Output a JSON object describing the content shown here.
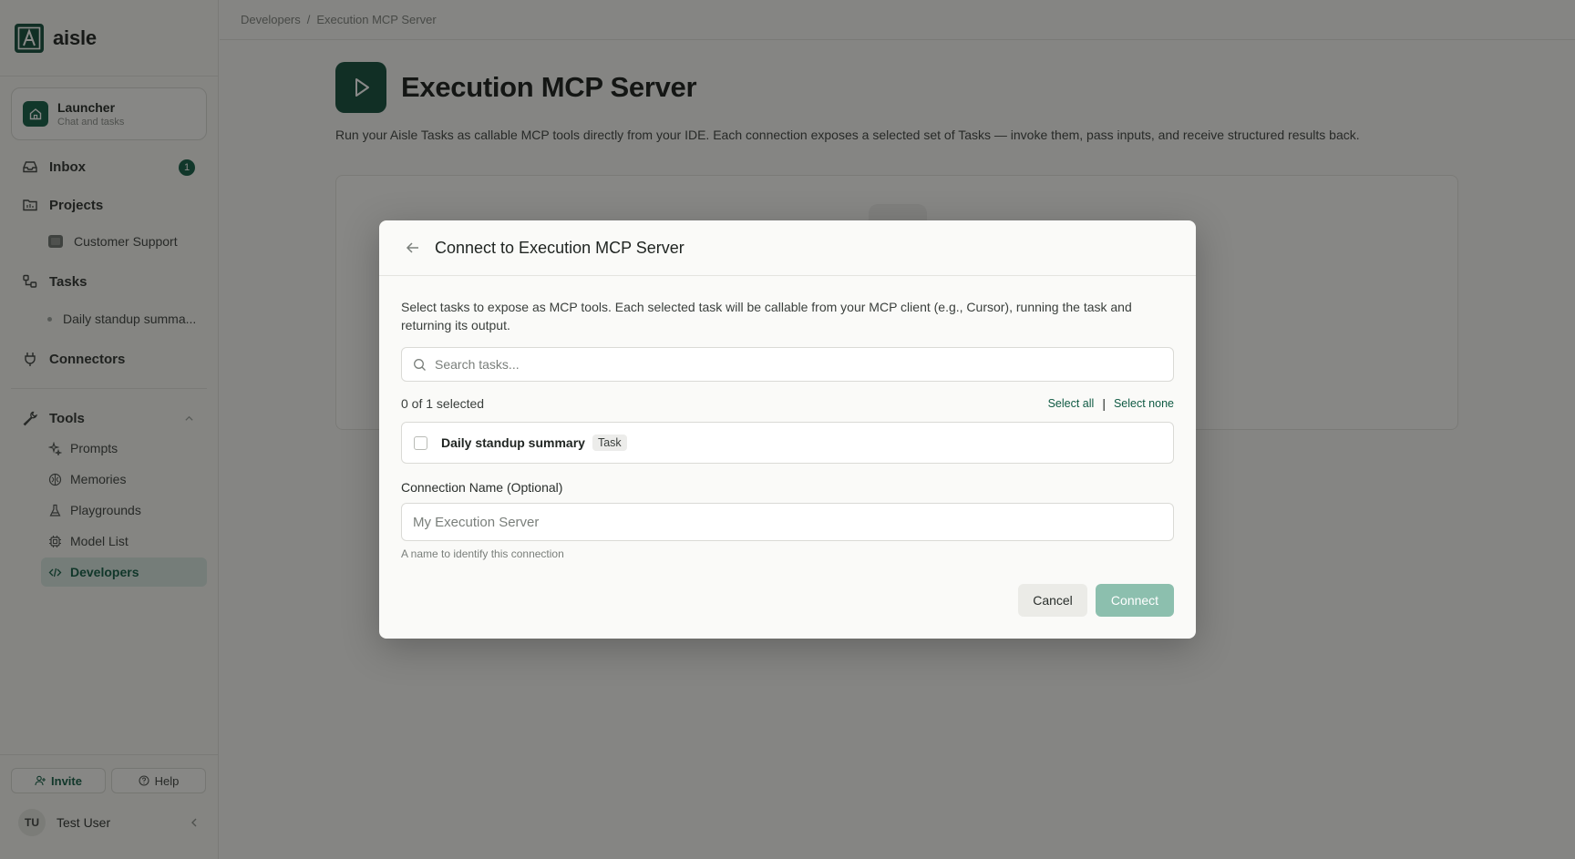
{
  "brand": {
    "name": "aisle"
  },
  "launcher": {
    "title": "Launcher",
    "subtitle": "Chat and tasks"
  },
  "nav": {
    "inbox": {
      "label": "Inbox",
      "badge": "1"
    },
    "projects": {
      "label": "Projects",
      "children": [
        "Customer Support"
      ]
    },
    "tasks": {
      "label": "Tasks",
      "children": [
        "Daily standup summa..."
      ]
    },
    "connectors": {
      "label": "Connectors"
    },
    "tools": {
      "label": "Tools",
      "items": [
        "Prompts",
        "Memories",
        "Playgrounds",
        "Model List",
        "Developers"
      ],
      "active": "Developers"
    }
  },
  "footer": {
    "invite_label": "Invite",
    "help_label": "Help"
  },
  "user": {
    "initials": "TU",
    "name": "Test User"
  },
  "breadcrumb": [
    "Developers",
    "Execution MCP Server"
  ],
  "page": {
    "title": "Execution MCP Server",
    "description": "Run your Aisle Tasks as callable MCP tools directly from your IDE. Each connection exposes a selected set of Tasks — invoke them, pass inputs, and receive structured results back."
  },
  "modal": {
    "title": "Connect to Execution MCP Server",
    "description": "Select tasks to expose as MCP tools. Each selected task will be callable from your MCP client (e.g., Cursor), running the task and returning its output.",
    "search_placeholder": "Search tasks...",
    "selection_count": "0 of 1 selected",
    "select_all_label": "Select all",
    "select_none_label": "Select none",
    "tasks": [
      {
        "name": "Daily standup summary",
        "tag": "Task",
        "checked": false
      }
    ],
    "connection_label": "Connection Name (Optional)",
    "connection_placeholder": "My Execution Server",
    "connection_hint": "A name to identify this connection",
    "cancel_label": "Cancel",
    "connect_label": "Connect"
  },
  "colors": {
    "brand": "#0f4a38",
    "accent": "#0f5a43",
    "connect_disabled": "#8cbfae",
    "active_nav_bg": "#d6e6e0"
  }
}
